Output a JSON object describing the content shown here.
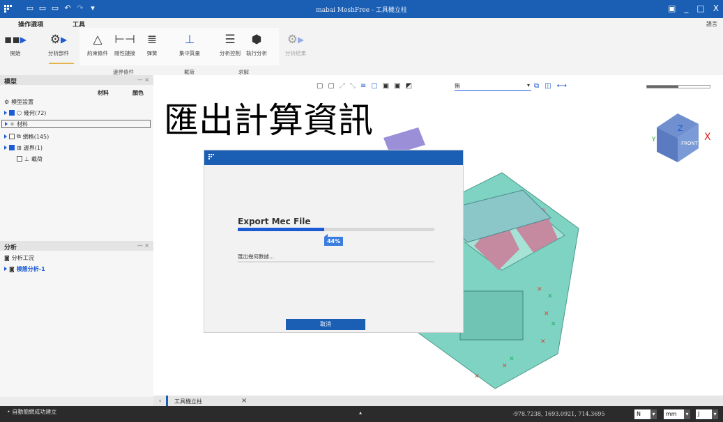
{
  "titlebar": {
    "title": "mabai MeshFree - 工具機立柱",
    "win_restore": "▣",
    "win_min": "_",
    "win_max": "□",
    "win_close": "X"
  },
  "ribbon": {
    "tabs": [
      "操作選項",
      "工具"
    ],
    "lang": "語言",
    "buttons": {
      "start": "開始",
      "analysis_component": "分析部件",
      "constraint": "約束條件",
      "rigid_link": "剛性鏈接",
      "spring": "彈簧",
      "concentrated_mass": "集中質量",
      "analysis_control": "分析控制",
      "run_analysis": "執行分析",
      "analysis_result": "分析結果"
    },
    "groups": {
      "boundary": "邊界條件",
      "load": "載荷",
      "solve": "求解"
    }
  },
  "model_panel": {
    "title": "模型",
    "pin": "— ×",
    "col_material": "材料",
    "col_color": "顏色",
    "items": [
      {
        "label": "模型設置"
      },
      {
        "label": "幾何(72)"
      },
      {
        "label": "材料"
      },
      {
        "label": "網格(145)"
      },
      {
        "label": "邊界(1)"
      },
      {
        "label": "載荷"
      }
    ]
  },
  "analysis_panel": {
    "title": "分析",
    "pin": "— ×",
    "items": [
      {
        "label": "分析工況"
      },
      {
        "label": "模態分析-1"
      }
    ]
  },
  "overlay_title": "匯出計算資訊",
  "viewport": {
    "view_select": "無",
    "cube_face": "FRONT",
    "axis_x": "X",
    "axis_z": "Z",
    "axis_y": "Y"
  },
  "dialog": {
    "heading": "Export Mec File",
    "progress": 0.44,
    "progress_label": "44%",
    "status": "匯出幾何數據...",
    "cancel": "取消"
  },
  "doc_tab": {
    "label": "工具機立柱",
    "close": "×"
  },
  "statusbar": {
    "message": "• 自動簡網成功建立",
    "coords": "-978.7238, 1693.0921, 714.3695",
    "unit_force": "N",
    "unit_length": "mm",
    "unit_time": "J"
  },
  "colors": {
    "accent": "#1a5fb4",
    "mesh": "#7fd3c3"
  }
}
